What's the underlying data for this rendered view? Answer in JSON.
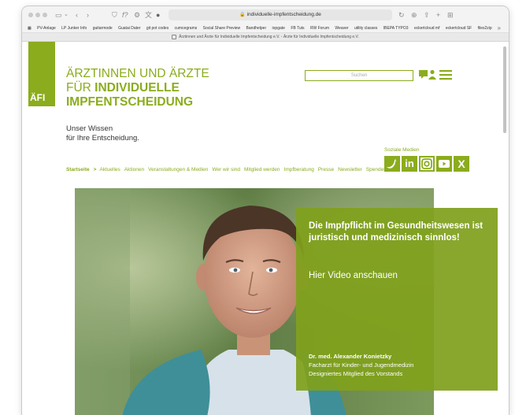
{
  "browser": {
    "url": "individuelle-impfentscheidung.de",
    "tab_title": "Ärztinnen und Ärzte für Individuelle Impfentscheidung e.V. - Ärzte für Individuelle Impfentscheidung e.V.",
    "bookmarks": [
      "PV-Anlage",
      "LP Junker Info",
      "guitarmode",
      "Guatai Dater",
      "git pot codes",
      "cumcegrams",
      "Social Share Preview",
      "Bandhelper",
      "iopgate",
      "FB Tuts",
      "RW Forum",
      "Weaver",
      "utility classes",
      "IBEPA TYPO3",
      "eckertcloud mf",
      "eckertcloud SF",
      "files2zip"
    ]
  },
  "site": {
    "logo_text": "ÄFI",
    "title_line1": "ÄRZTINNEN UND ÄRZTE",
    "title_line2_prefix": "FÜR ",
    "title_line2_bold": "INDIVIDUELLE",
    "title_line3": "IMPFENTSCHEIDUNG",
    "tagline_line1": "Unser Wissen",
    "tagline_line2": "für Ihre Entscheidung.",
    "search_placeholder": "Suchen",
    "social_label": "Soziale Medien",
    "social": [
      {
        "name": "twitter",
        "icon": "twitter-icon"
      },
      {
        "name": "linkedin",
        "icon": "linkedin-icon",
        "glyph": "in"
      },
      {
        "name": "instagram",
        "icon": "instagram-icon"
      },
      {
        "name": "youtube",
        "icon": "youtube-icon"
      },
      {
        "name": "xing",
        "icon": "xing-icon",
        "glyph": "X"
      }
    ],
    "nav": {
      "active": "Startseite",
      "separator": ">",
      "items": [
        "Aktuelles",
        "Aktionen",
        "Veranstaltungen & Medien",
        "Wer wir sind",
        "Mitglied werden",
        "Impfberatung",
        "Presse",
        "Newsletter",
        "Spenden"
      ]
    },
    "hero": {
      "headline": "Die Impfpflicht im Gesundheitswesen ist juristisch und medizinisch sinnlos!",
      "video_link": "Hier Video anschauen",
      "person_name": "Dr. med. Alexander Konietzky",
      "person_role1": "Facharzt für Kinder- und Jugendmedizin",
      "person_role2": "Designiertes Mitglied des Vorstands"
    },
    "accent_color": "#8bac1c"
  }
}
